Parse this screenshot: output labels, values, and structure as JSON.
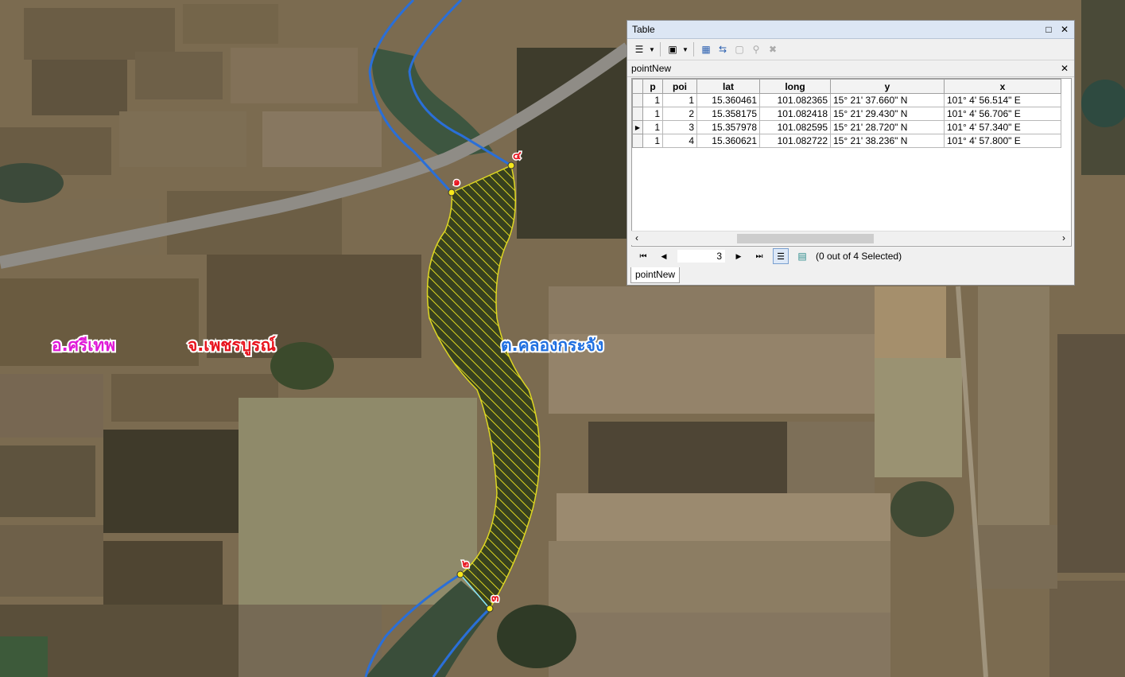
{
  "map": {
    "labels": {
      "district": "อ.ศรีเทพ",
      "province": "จ.เพชรบูรณ์",
      "subdistrict": "ต.คลองกระจัง"
    },
    "points": [
      {
        "label": "๑"
      },
      {
        "label": "๒"
      },
      {
        "label": "๓"
      },
      {
        "label": "๔"
      }
    ],
    "colors": {
      "district": "#e01ad8",
      "province": "#e8141e",
      "subdistrict": "#1f6fe0",
      "polygon_hatch": "#f6f01c",
      "stream": "#2a6fd8"
    }
  },
  "table_window": {
    "title": "Table",
    "layer_name": "pointNew",
    "columns": [
      "p",
      "poi",
      "lat",
      "long",
      "y",
      "x"
    ],
    "rows": [
      {
        "p": "1",
        "poi": "1",
        "lat": "15.360461",
        "long": "101.082365",
        "y": "15° 21' 37.660\" N",
        "x": "101° 4' 56.514\" E"
      },
      {
        "p": "1",
        "poi": "2",
        "lat": "15.358175",
        "long": "101.082418",
        "y": "15° 21' 29.430\" N",
        "x": "101° 4' 56.706\" E"
      },
      {
        "p": "1",
        "poi": "3",
        "lat": "15.357978",
        "long": "101.082595",
        "y": "15° 21' 28.720\" N",
        "x": "101° 4' 57.340\" E"
      },
      {
        "p": "1",
        "poi": "4",
        "lat": "15.360621",
        "long": "101.082722",
        "y": "15° 21' 38.236\" N",
        "x": "101° 4' 57.800\" E"
      }
    ],
    "current_record": "3",
    "selection_status": "(0 out of 4 Selected)",
    "tab_label": "pointNew"
  }
}
